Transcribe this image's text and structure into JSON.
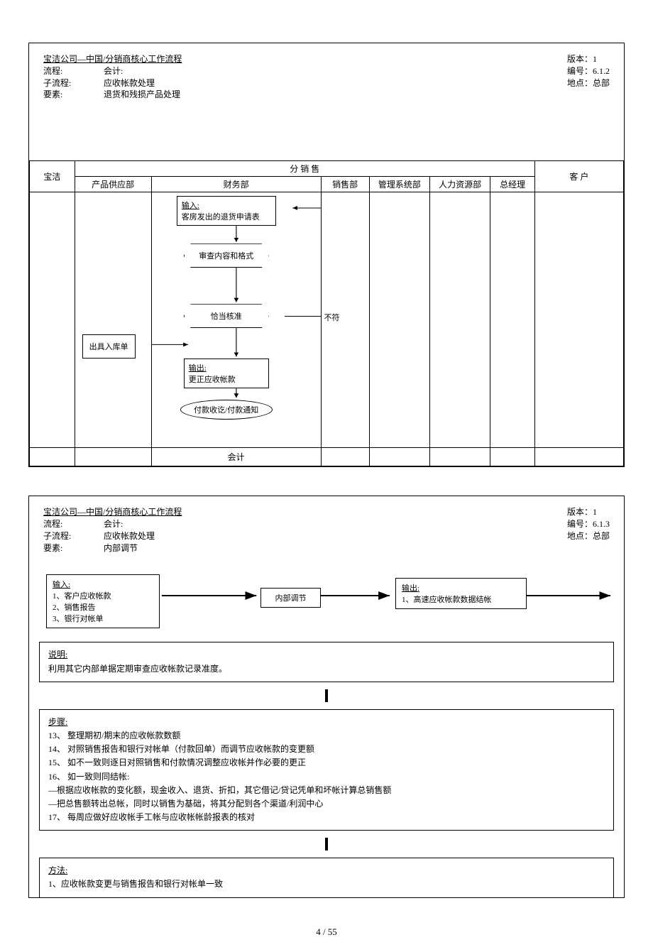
{
  "doc1": {
    "title": "宝洁公司—中国/分销商核心工作流程",
    "rows": [
      {
        "k": "流程:",
        "v": "会计:"
      },
      {
        "k": "子流程:",
        "v": "应收帐款处理"
      },
      {
        "k": "要素:",
        "v": "退货和残损产品处理"
      }
    ],
    "meta": [
      "版本：1",
      "编号：6.1.2",
      "地点：总部"
    ],
    "lanes": {
      "l0": "宝洁",
      "group": "分   销   售",
      "sub": [
        "产品供应部",
        "财务部",
        "销售部",
        "管理系统部",
        "人力资源部",
        "总经理"
      ],
      "cust": "客   户"
    },
    "nodes": {
      "input_t": "输入:",
      "input_v": "客房发出的退货申请表",
      "n1": "审查内容和格式",
      "n2": "恰当核准",
      "neg": "不符",
      "side": "出具入库单",
      "out_t": "输出:",
      "out_v": "更正应收帐款",
      "oval": "付款收讫/付款通知"
    },
    "footer": "会计"
  },
  "doc2": {
    "title": "宝洁公司—中国/分销商核心工作流程",
    "rows": [
      {
        "k": "流程:",
        "v": "会计:"
      },
      {
        "k": "子流程:",
        "v": "应收帐款处理"
      },
      {
        "k": "要素:",
        "v": "内部调节"
      }
    ],
    "meta": [
      "版本：1",
      "编号：6.1.3",
      "地点：总部"
    ],
    "flow": {
      "in_t": "输入:",
      "in_lines": [
        "1、客户应收帐款",
        "2、销售报告",
        "3、银行对帐单"
      ],
      "proc": "内部调节",
      "out_t": "输出:",
      "out_lines": [
        "1、高速应收帐款数据结帐"
      ]
    },
    "desc_t": "说明:",
    "desc_v": "利用其它内部单据定期审查应收帐款记录准度。",
    "steps_t": "步骤:",
    "steps": [
      "13、  整理期初/期末的应收帐款数额",
      "14、  对照销售报告和银行对帐单（付款回单）而调节应收帐款的变更额",
      "15、  如不一致则逐日对照销售和付款情况调整应收帐并作必要的更正",
      "16、  如一致则同结帐:",
      "—根据应收帐款的变化额，现金收入、退货、折扣，其它借记/贷记凭单和坏帐计算总销售额",
      "—把总售额转出总帐，同时以销售为基础，将其分配到各个渠道/利润中心",
      "17、  每周应做好应收帐手工帐与应收帐帐龄报表的核对"
    ],
    "method_t": "方法:",
    "method": [
      "1、应收帐款变更与销售报告和银行对帐单一致"
    ]
  },
  "page": "4  /  55"
}
